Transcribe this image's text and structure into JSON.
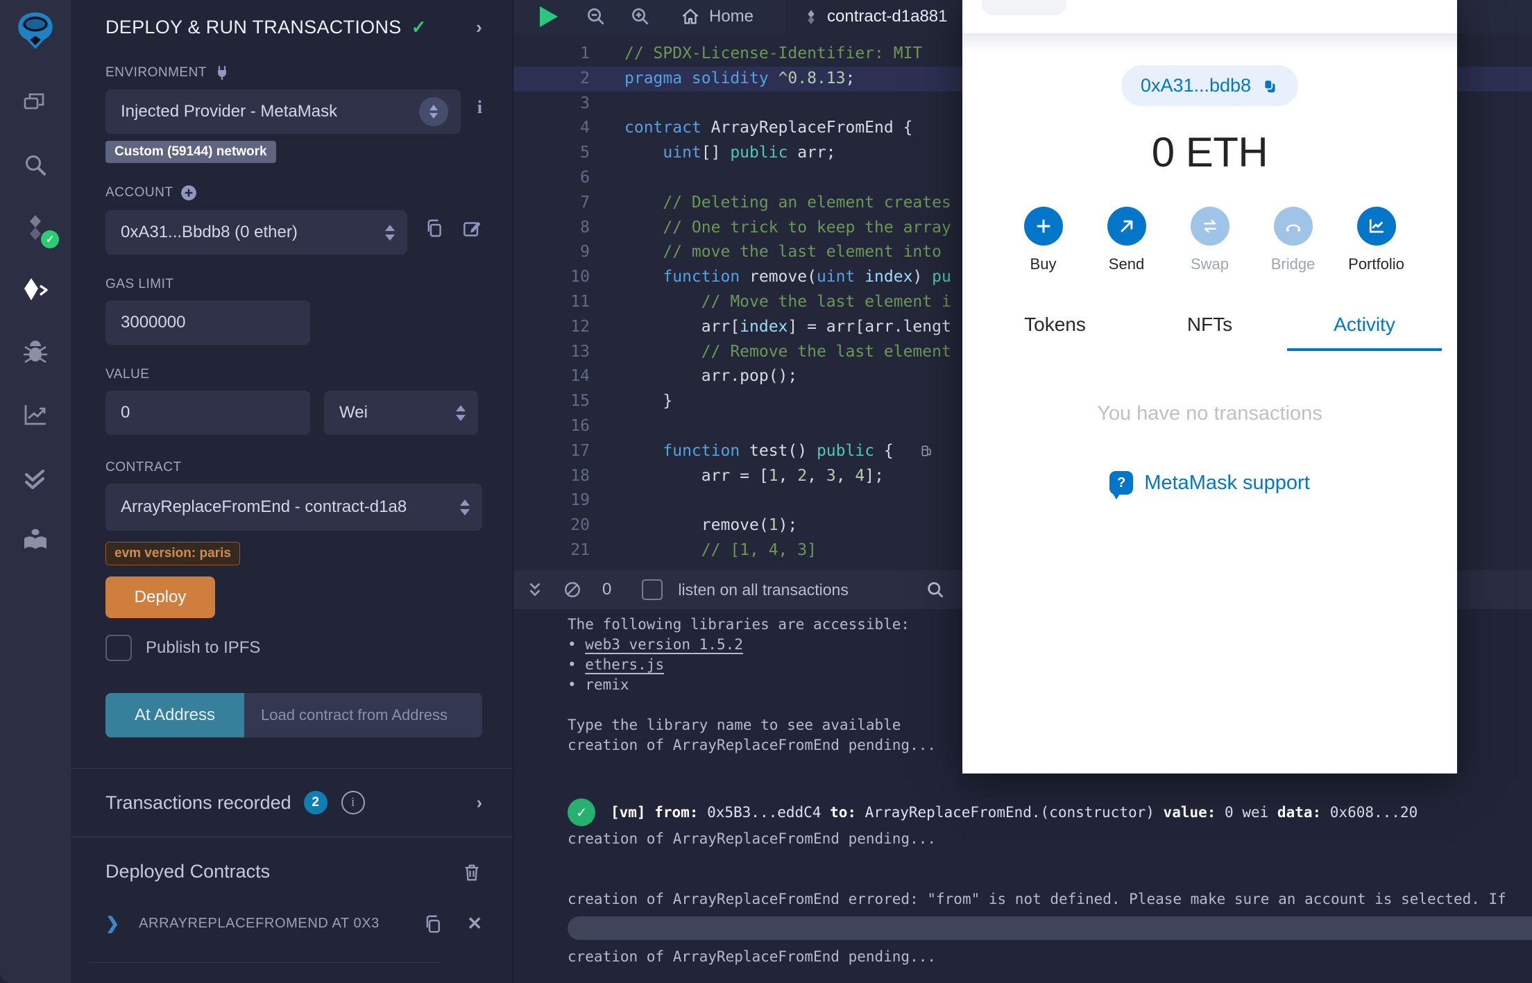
{
  "icon_bar": {
    "items": [
      "remix-logo",
      "file-explorer",
      "search",
      "solidity-compiler",
      "deploy-and-run",
      "debugger",
      "analytics",
      "static-analysis",
      "plugin-manager"
    ],
    "active_item": "deploy-and-run",
    "compiler_badge": "success-check"
  },
  "side_panel": {
    "title": "DEPLOY & RUN TRANSACTIONS",
    "environment_label": "ENVIRONMENT",
    "environment_value": "Injected Provider - MetaMask",
    "network_badge": "Custom (59144) network",
    "account_label": "ACCOUNT",
    "account_value": "0xA31...Bbdb8 (0 ether)",
    "gas_limit_label": "GAS LIMIT",
    "gas_limit_value": "3000000",
    "value_label": "VALUE",
    "value_value": "0",
    "value_unit": "Wei",
    "contract_label": "CONTRACT",
    "contract_value": "ArrayReplaceFromEnd - contract-d1a8",
    "evm_badge": "evm version: paris",
    "deploy_button": "Deploy",
    "publish_label": "Publish to IPFS",
    "at_address_button": "At Address",
    "at_address_placeholder": "Load contract from Address",
    "transactions_recorded_label": "Transactions recorded",
    "transactions_recorded_count": "2",
    "deployed_contracts_title": "Deployed Contracts",
    "deployed_contract_item": "ARRAYREPLACEFROMEND AT 0X3"
  },
  "editor": {
    "tab_home": "Home",
    "tab_active": "contract-d1a881",
    "lines": [
      {
        "n": 1,
        "seg": [
          [
            "// SPDX-License-Identifier: MIT",
            "cm"
          ]
        ]
      },
      {
        "n": 2,
        "hl": true,
        "seg": [
          [
            "pragma solidity ",
            "kw"
          ],
          [
            "^0.8.13",
            "nu"
          ],
          [
            ";",
            "pl"
          ]
        ]
      },
      {
        "n": 3,
        "seg": []
      },
      {
        "n": 4,
        "seg": [
          [
            "contract",
            "kw"
          ],
          [
            " ArrayReplaceFromEnd {",
            "pl"
          ]
        ]
      },
      {
        "n": 5,
        "seg": [
          [
            "    ",
            "pl"
          ],
          [
            "uint",
            "kw"
          ],
          [
            "[] ",
            "pl"
          ],
          [
            "public",
            "ty"
          ],
          [
            " arr;",
            "pl"
          ]
        ]
      },
      {
        "n": 6,
        "seg": []
      },
      {
        "n": 7,
        "seg": [
          [
            "    ",
            "pl"
          ],
          [
            "// Deleting an element creates",
            "cm"
          ]
        ]
      },
      {
        "n": 8,
        "seg": [
          [
            "    ",
            "pl"
          ],
          [
            "// One trick to keep the array",
            "cm"
          ]
        ]
      },
      {
        "n": 9,
        "seg": [
          [
            "    ",
            "pl"
          ],
          [
            "// move the last element into",
            "cm"
          ]
        ]
      },
      {
        "n": 10,
        "seg": [
          [
            "    ",
            "pl"
          ],
          [
            "function",
            "kw"
          ],
          [
            " remove(",
            "pl"
          ],
          [
            "uint",
            "kw"
          ],
          [
            " ",
            "pl"
          ],
          [
            "index",
            "pr"
          ],
          [
            ") ",
            "pl"
          ],
          [
            "pu",
            "ty"
          ]
        ]
      },
      {
        "n": 11,
        "seg": [
          [
            "        ",
            "pl"
          ],
          [
            "// Move the last element i",
            "cm"
          ]
        ]
      },
      {
        "n": 12,
        "seg": [
          [
            "        arr[",
            "pl"
          ],
          [
            "index",
            "pr"
          ],
          [
            "] = arr[arr.lengt",
            "pl"
          ]
        ]
      },
      {
        "n": 13,
        "seg": [
          [
            "        ",
            "pl"
          ],
          [
            "// Remove the last element",
            "cm"
          ]
        ]
      },
      {
        "n": 14,
        "seg": [
          [
            "        arr.pop();",
            "pl"
          ]
        ]
      },
      {
        "n": 15,
        "seg": [
          [
            "    }",
            "pl"
          ]
        ]
      },
      {
        "n": 16,
        "seg": []
      },
      {
        "n": 17,
        "gas": true,
        "seg": [
          [
            "    ",
            "pl"
          ],
          [
            "function",
            "kw"
          ],
          [
            " test() ",
            "pl"
          ],
          [
            "public",
            "ty"
          ],
          [
            " {",
            "pl"
          ]
        ]
      },
      {
        "n": 18,
        "seg": [
          [
            "        arr = [",
            "pl"
          ],
          [
            "1",
            "nu"
          ],
          [
            ", ",
            "pl"
          ],
          [
            "2",
            "nu"
          ],
          [
            ", ",
            "pl"
          ],
          [
            "3",
            "nu"
          ],
          [
            ", ",
            "pl"
          ],
          [
            "4",
            "nu"
          ],
          [
            "];",
            "pl"
          ]
        ]
      },
      {
        "n": 19,
        "seg": []
      },
      {
        "n": 20,
        "seg": [
          [
            "        remove(",
            "pl"
          ],
          [
            "1",
            "nu"
          ],
          [
            ");",
            "pl"
          ]
        ]
      },
      {
        "n": 21,
        "seg": [
          [
            "        ",
            "pl"
          ],
          [
            "// [1, 4, 3]",
            "cm"
          ]
        ]
      }
    ]
  },
  "terminal": {
    "badge_count": "0",
    "listen_label": "listen on all transactions",
    "lines": [
      {
        "type": "text",
        "text": "The following libraries are accessible:"
      },
      {
        "type": "bullet-link",
        "text": "web3 version 1.5.2"
      },
      {
        "type": "bullet-link",
        "text": "ethers.js"
      },
      {
        "type": "bullet",
        "text": "remix"
      },
      {
        "type": "blank"
      },
      {
        "type": "text",
        "text": "Type the library name to see available "
      },
      {
        "type": "text",
        "text": "creation of ArrayReplaceFromEnd pending..."
      },
      {
        "type": "blank"
      },
      {
        "type": "blank"
      },
      {
        "type": "vm",
        "seg": [
          [
            "[vm] ",
            "b"
          ],
          [
            "from:",
            "b"
          ],
          [
            " 0x5B3...eddC4 ",
            ""
          ],
          [
            "to:",
            "b"
          ],
          [
            " ArrayReplaceFromEnd.(constructor) ",
            ""
          ],
          [
            "value:",
            "b"
          ],
          [
            " 0 wei ",
            ""
          ],
          [
            "data:",
            "b"
          ],
          [
            " 0x608...20",
            ""
          ]
        ]
      },
      {
        "type": "text",
        "text": "creation of ArrayReplaceFromEnd pending..."
      },
      {
        "type": "blank"
      },
      {
        "type": "blank"
      },
      {
        "type": "text",
        "text": "creation of ArrayReplaceFromEnd errored: \"from\" is not defined. Please make sure an account is selected. If"
      },
      {
        "type": "scrollbar"
      },
      {
        "type": "text",
        "text": "creation of ArrayReplaceFromEnd pending..."
      }
    ]
  },
  "metamask": {
    "accent_color": "#0376c9",
    "account_pill": "0xA31...bdb8",
    "balance": "0 ETH",
    "actions": [
      {
        "label": "Buy",
        "icon": "plus-icon",
        "enabled": true
      },
      {
        "label": "Send",
        "icon": "send-arrow-icon",
        "enabled": true
      },
      {
        "label": "Swap",
        "icon": "swap-arrows-icon",
        "enabled": false
      },
      {
        "label": "Bridge",
        "icon": "bridge-icon",
        "enabled": false
      },
      {
        "label": "Portfolio",
        "icon": "portfolio-chart-icon",
        "enabled": true
      }
    ],
    "tabs": [
      {
        "label": "Tokens",
        "active": false
      },
      {
        "label": "NFTs",
        "active": false
      },
      {
        "label": "Activity",
        "active": true
      }
    ],
    "empty_text": "You have no transactions",
    "support_link": "MetaMask support"
  }
}
